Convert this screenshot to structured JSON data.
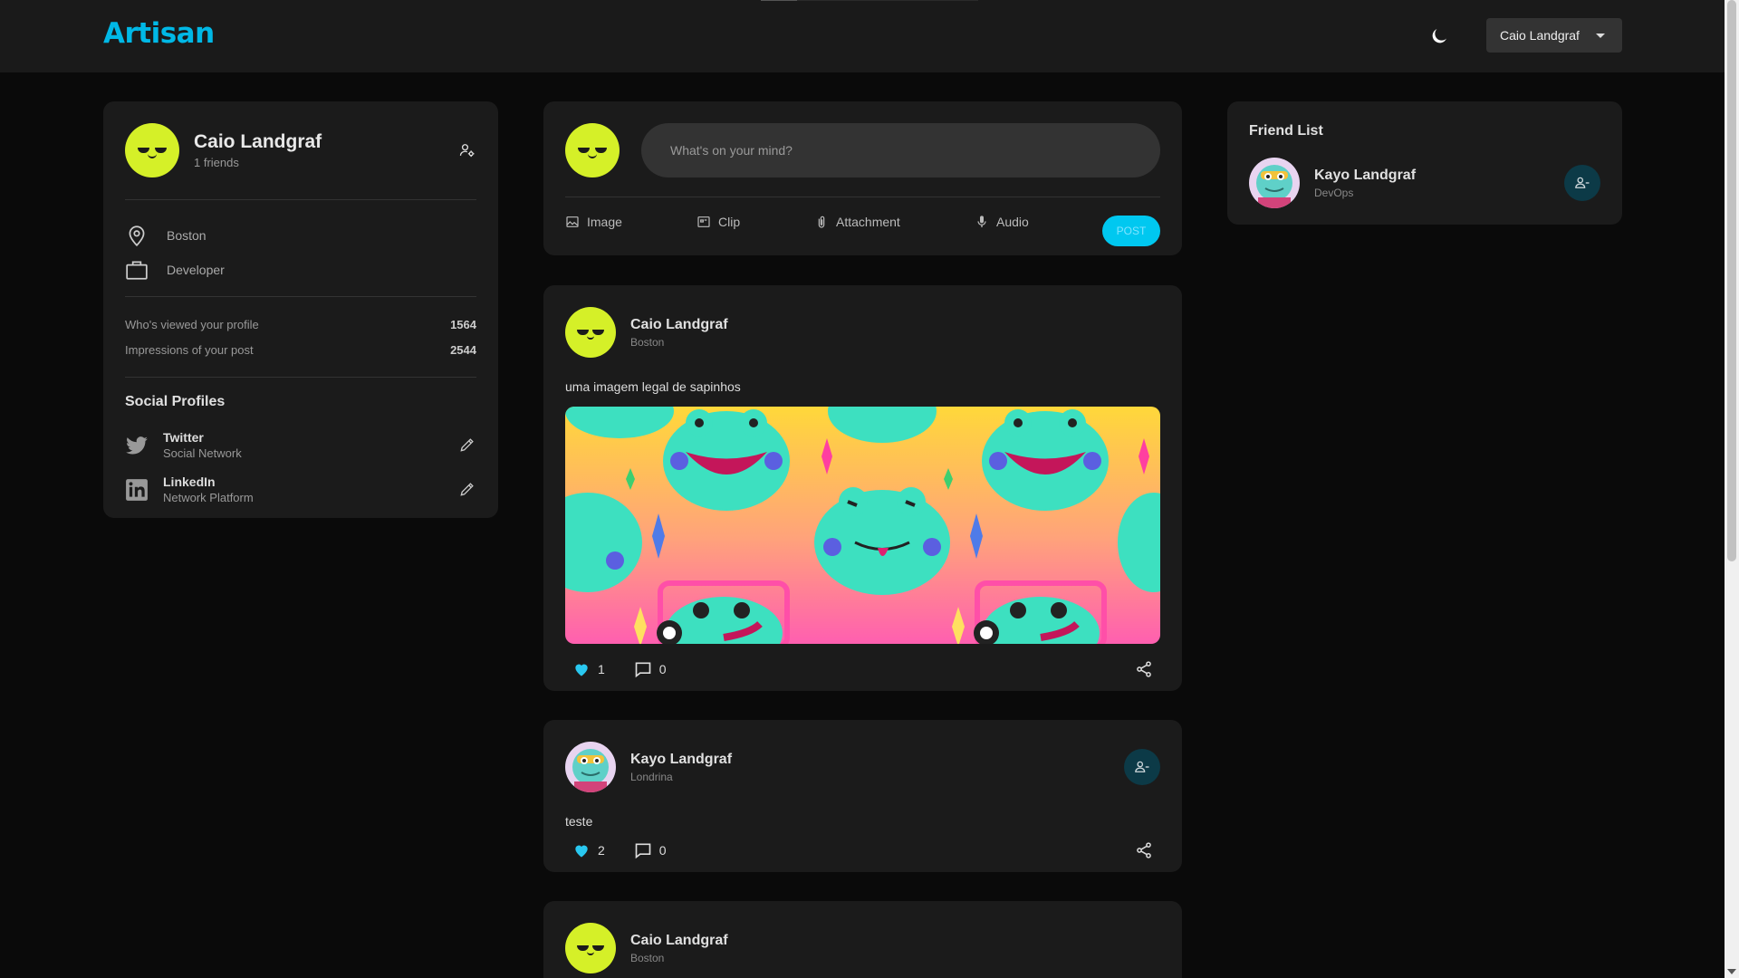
{
  "navbar": {
    "brand": "Artisan",
    "user_menu_label": "Caio Landgraf"
  },
  "profile": {
    "name": "Caio Landgraf",
    "friends": "1 friends",
    "location": "Boston",
    "occupation": "Developer",
    "stats": [
      {
        "label": "Who's viewed your profile",
        "value": "1564"
      },
      {
        "label": "Impressions of your post",
        "value": "2544"
      }
    ],
    "social_title": "Social Profiles",
    "social": [
      {
        "name": "Twitter",
        "sub": "Social Network",
        "icon": "twitter-icon"
      },
      {
        "name": "LinkedIn",
        "sub": "Network Platform",
        "icon": "linkedin-icon"
      }
    ]
  },
  "composer": {
    "placeholder": "What's on your mind?",
    "actions": [
      {
        "label": "Image",
        "icon": "image-icon"
      },
      {
        "label": "Clip",
        "icon": "clip-icon"
      },
      {
        "label": "Attachment",
        "icon": "paperclip-icon"
      },
      {
        "label": "Audio",
        "icon": "microphone-icon"
      }
    ],
    "post_label": "POST"
  },
  "posts": [
    {
      "author": "Caio Landgraf",
      "location": "Boston",
      "text": "uma imagem legal de sapinhos",
      "likes": "1",
      "comments": "0"
    },
    {
      "author": "Kayo Landgraf",
      "location": "Londrina",
      "text": "teste",
      "likes": "2",
      "comments": "0"
    },
    {
      "author": "Caio Landgraf",
      "location": "Boston"
    }
  ],
  "friend_list": {
    "title": "Friend List",
    "friends": [
      {
        "name": "Kayo Landgraf",
        "role": "DevOps"
      }
    ]
  },
  "colors": {
    "accent": "#00c8f0",
    "brand": "#00b8e6",
    "avatar": "#d5f028",
    "like": "#29c8f0"
  }
}
